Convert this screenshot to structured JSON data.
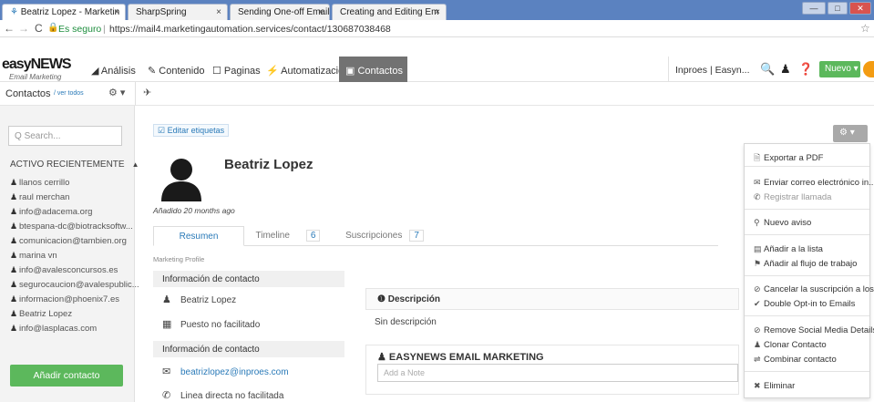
{
  "browser": {
    "tabs": [
      {
        "label": "Beatriz Lopez - Marketin"
      },
      {
        "label": "SharpSpring"
      },
      {
        "label": "Sending One-off Emails"
      },
      {
        "label": "Creating and Editing Em"
      }
    ],
    "window_buttons": [
      "—",
      "□",
      "✕"
    ],
    "secure_label": "Es seguro",
    "url": "https://mail4.marketingautomation.services/contact/130687038468"
  },
  "app": {
    "logo_main": "easyNEWS",
    "logo_sub": "Email Marketing",
    "nav": [
      "Análisis",
      "Contenido",
      "Paginas",
      "Automatización",
      "Contactos"
    ],
    "account": "Inproes | Easyn...",
    "new_button": "Nuevo"
  },
  "subnav": {
    "title": "Contactos",
    "view_all": "/ ver todos"
  },
  "sidebar": {
    "search_placeholder": "Search...",
    "section_title": "ACTIVO RECIENTEMENTE",
    "items": [
      "llanos cerrillo",
      "raul merchan",
      "info@adacema.org",
      "btespana-dc@biotracksoftw...",
      "comunicacion@tambien.org",
      "marina vn",
      "info@avalesconcursos.es",
      "segurocaucion@avalespublic...",
      "informacion@phoenix7.es",
      "Beatriz Lopez",
      "info@lasplacas.com"
    ],
    "add_button": "Añadir contacto"
  },
  "contact": {
    "edit_tags": "Editar etiquetas",
    "name": "Beatriz Lopez",
    "added": "Añadido 20 months ago",
    "tabs": [
      {
        "label": "Resumen"
      },
      {
        "label": "Timeline",
        "count": "6"
      },
      {
        "label": "Suscripciones",
        "count": "7"
      }
    ],
    "profile_label": "Marketing Profile",
    "info_header_1": "Información de contacto",
    "contact_name": "Beatriz Lopez",
    "position": "Puesto no facilitado",
    "info_header_2": "Información de contacto",
    "email": "beatrizlopez@inproes.com",
    "phone": "Linea directa no facilitada",
    "desc_header": "Descripción",
    "desc_text": "Sin descripción",
    "email_mkt_header": "EASYNEWS EMAIL MARKETING",
    "note_placeholder": "Add a Note"
  },
  "menu": {
    "export_pdf": "Exportar a PDF",
    "send_email": "Enviar correo electrónico in...",
    "log_call": "Registrar llamada",
    "new_notice": "Nuevo aviso",
    "add_list": "Añadir a la lista",
    "add_workflow": "Añadir al flujo de trabajo",
    "unsubscribe": "Cancelar la suscripción a los...",
    "double_optin": "Double Opt-in to Emails",
    "remove_social": "Remove Social Media Details",
    "clone": "Clonar Contacto",
    "merge": "Combinar contacto",
    "delete": "Eliminar"
  },
  "colors": {
    "accent": "#5cb85c",
    "orange": "#f39c12",
    "link": "#2a7ab8",
    "active_nav": "#727272"
  }
}
